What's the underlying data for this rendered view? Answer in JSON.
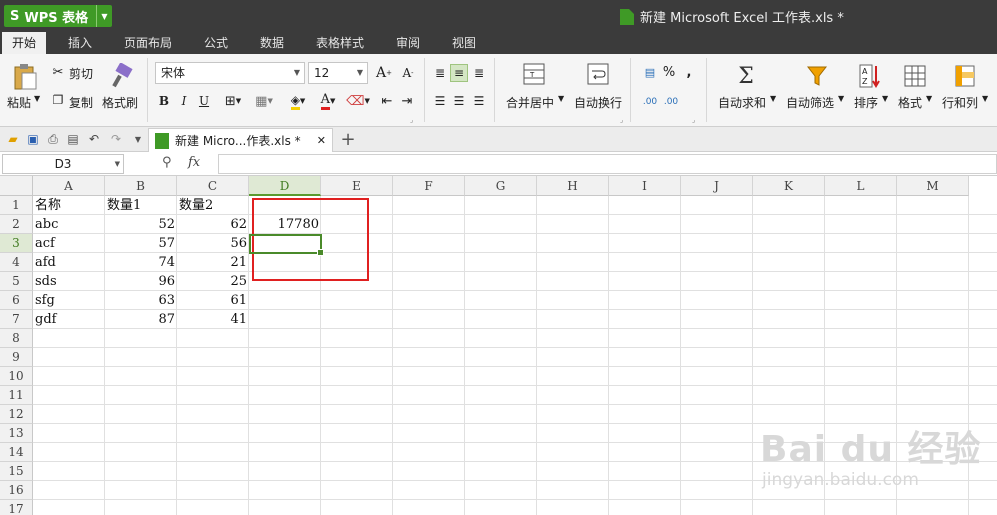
{
  "app": {
    "title": "WPS 表格",
    "document_title": "新建 Microsoft Excel 工作表.xls *"
  },
  "menu": [
    "开始",
    "插入",
    "页面布局",
    "公式",
    "数据",
    "表格样式",
    "审阅",
    "视图"
  ],
  "ribbon": {
    "paste": "粘贴",
    "cut": "剪切",
    "copy": "复制",
    "format_painter": "格式刷",
    "font_name": "宋体",
    "font_size": "12",
    "bold": "B",
    "italic": "I",
    "underline": "U",
    "merge_center": "合并居中",
    "wrap_text": "自动换行",
    "percent": "%",
    "comma": ",",
    "inc_decimal": ".00",
    "dec_decimal": ".00",
    "autosum": "自动求和",
    "autofilter": "自动筛选",
    "sort": "排序",
    "format": "格式",
    "rows_cols": "行和列"
  },
  "tab": {
    "label": "新建 Micro...作表.xls *"
  },
  "formula_bar": {
    "name_box": "D3",
    "fx": "fx",
    "value": ""
  },
  "sheet": {
    "columns": [
      "A",
      "B",
      "C",
      "D",
      "E",
      "F",
      "G",
      "H",
      "I",
      "J",
      "K",
      "L",
      "M"
    ],
    "rows": [
      "1",
      "2",
      "3",
      "4",
      "5",
      "6",
      "7",
      "8",
      "9",
      "10",
      "11",
      "12",
      "13",
      "14",
      "15",
      "16",
      "17"
    ],
    "selected_column": "D",
    "selected_row": "3",
    "cells": [
      {
        "row": 1,
        "col": "A",
        "value": "名称"
      },
      {
        "row": 1,
        "col": "B",
        "value": "数量1"
      },
      {
        "row": 1,
        "col": "C",
        "value": "数量2"
      },
      {
        "row": 2,
        "col": "A",
        "value": "abc"
      },
      {
        "row": 2,
        "col": "B",
        "value": "52",
        "num": true
      },
      {
        "row": 2,
        "col": "C",
        "value": "62",
        "num": true
      },
      {
        "row": 2,
        "col": "D",
        "value": "17780",
        "num": true
      },
      {
        "row": 3,
        "col": "A",
        "value": "acf"
      },
      {
        "row": 3,
        "col": "B",
        "value": "57",
        "num": true
      },
      {
        "row": 3,
        "col": "C",
        "value": "56",
        "num": true
      },
      {
        "row": 4,
        "col": "A",
        "value": "afd"
      },
      {
        "row": 4,
        "col": "B",
        "value": "74",
        "num": true
      },
      {
        "row": 4,
        "col": "C",
        "value": "21",
        "num": true
      },
      {
        "row": 5,
        "col": "A",
        "value": "sds"
      },
      {
        "row": 5,
        "col": "B",
        "value": "96",
        "num": true
      },
      {
        "row": 5,
        "col": "C",
        "value": "25",
        "num": true
      },
      {
        "row": 6,
        "col": "A",
        "value": "sfg"
      },
      {
        "row": 6,
        "col": "B",
        "value": "63",
        "num": true
      },
      {
        "row": 6,
        "col": "C",
        "value": "61",
        "num": true
      },
      {
        "row": 7,
        "col": "A",
        "value": "gdf"
      },
      {
        "row": 7,
        "col": "B",
        "value": "87",
        "num": true
      },
      {
        "row": 7,
        "col": "C",
        "value": "41",
        "num": true
      }
    ]
  },
  "watermark": {
    "brand": "Bai du 经验",
    "url": "jingyan.baidu.com"
  },
  "colors": {
    "accent": "#3f9a26",
    "selection": "#4a8a2a",
    "annotation": "#e02020"
  }
}
